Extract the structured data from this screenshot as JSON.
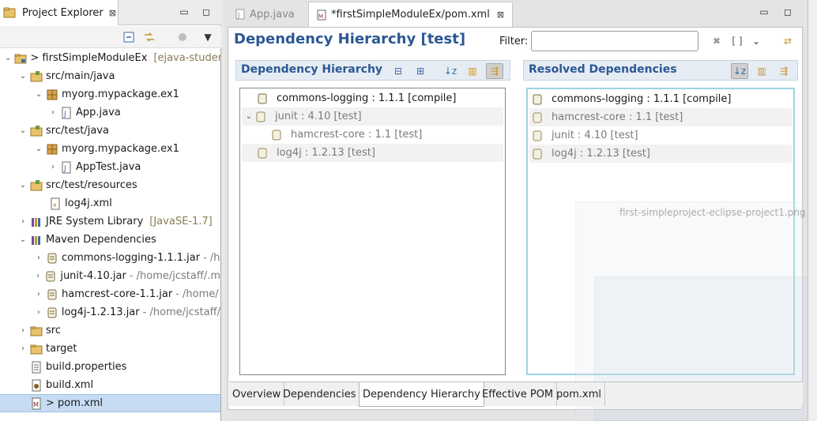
{
  "explorer": {
    "title": "Project Explorer",
    "close_glyph": "⊠",
    "minimize_glyph": "▭",
    "maximize_glyph": "◻",
    "menu_glyph": "▼"
  },
  "tree": {
    "items": [
      {
        "label": "> firstSimpleModuleEx",
        "suffix": "[ejava-studer",
        "path": ""
      },
      {
        "label": "src/main/java",
        "suffix": "",
        "path": ""
      },
      {
        "label": "myorg.mypackage.ex1",
        "suffix": "",
        "path": ""
      },
      {
        "label": "App.java",
        "suffix": "",
        "path": ""
      },
      {
        "label": "src/test/java",
        "suffix": "",
        "path": ""
      },
      {
        "label": "myorg.mypackage.ex1",
        "suffix": "",
        "path": ""
      },
      {
        "label": "AppTest.java",
        "suffix": "",
        "path": ""
      },
      {
        "label": "src/test/resources",
        "suffix": "",
        "path": ""
      },
      {
        "label": "log4j.xml",
        "suffix": "",
        "path": ""
      },
      {
        "label": "JRE System Library",
        "suffix": "[JavaSE-1.7]",
        "path": ""
      },
      {
        "label": "Maven Dependencies",
        "suffix": "",
        "path": ""
      },
      {
        "label": "commons-logging-1.1.1.jar",
        "suffix": "",
        "path": "- /h"
      },
      {
        "label": "junit-4.10.jar",
        "suffix": "",
        "path": "- /home/jcstaff/.m"
      },
      {
        "label": "hamcrest-core-1.1.jar",
        "suffix": "",
        "path": "- /home/"
      },
      {
        "label": "log4j-1.2.13.jar",
        "suffix": "",
        "path": "- /home/jcstaff/"
      },
      {
        "label": "src",
        "suffix": "",
        "path": ""
      },
      {
        "label": "target",
        "suffix": "",
        "path": ""
      },
      {
        "label": "build.properties",
        "suffix": "",
        "path": ""
      },
      {
        "label": "build.xml",
        "suffix": "",
        "path": ""
      },
      {
        "label": "> pom.xml",
        "suffix": "",
        "path": ""
      }
    ]
  },
  "editor": {
    "tabs": [
      {
        "label": "App.java"
      },
      {
        "label": "*firstSimpleModuleEx/pom.xml"
      }
    ],
    "page_title": "Dependency Hierarchy [test]",
    "filter_label": "Filter:",
    "filter_value": "",
    "hierarchy_title": "Dependency Hierarchy",
    "resolved_title": "Resolved Dependencies",
    "hierarchy": [
      {
        "label": "commons-logging : 1.1.1 [compile]",
        "dim": false
      },
      {
        "label": "junit : 4.10 [test]",
        "dim": true
      },
      {
        "label": "hamcrest-core : 1.1 [test]",
        "dim": true
      },
      {
        "label": "log4j : 1.2.13 [test]",
        "dim": true
      }
    ],
    "resolved": [
      {
        "label": "commons-logging : 1.1.1 [compile]",
        "dim": false
      },
      {
        "label": "hamcrest-core : 1.1 [test]",
        "dim": true
      },
      {
        "label": "junit : 4.10 [test]",
        "dim": true
      },
      {
        "label": "log4j : 1.2.13 [test]",
        "dim": true
      }
    ],
    "bottom_tabs": [
      {
        "label": "Overview"
      },
      {
        "label": "Dependencies"
      },
      {
        "label": "Dependency Hierarchy"
      },
      {
        "label": "Effective POM"
      },
      {
        "label": "pom.xml"
      }
    ]
  },
  "ghost": {
    "label": "first-simpleproject-eclipse-project1.png"
  },
  "colors": {
    "title_blue": "#2b5893",
    "selection": "#c7dcf2",
    "focus_border": "#9fd3e0"
  }
}
